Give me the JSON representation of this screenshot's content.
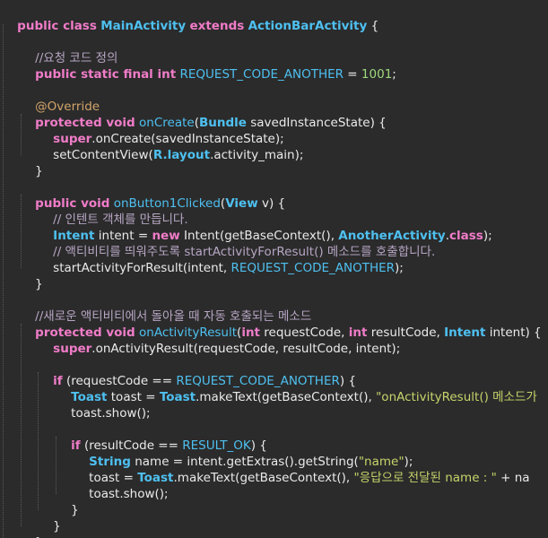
{
  "code": {
    "class_kw": "public class",
    "class_name": "MainActivity",
    "extends_kw": "extends",
    "parent_class": "ActionBarActivity",
    "open_brace": "{",
    "comment_request_code": "//요청 코드 정의",
    "const_modifiers": "public static final int",
    "const_name": "REQUEST_CODE_ANOTHER",
    "const_eq": " = ",
    "const_value": "1001",
    "semicolon": ";",
    "override": "@Override",
    "protected_void": "protected void",
    "on_create": "onCreate",
    "bundle_type": "Bundle",
    "saved_param": " savedInstanceState) {",
    "super_kw": "super",
    "super_on_create": ".onCreate(savedInstanceState);",
    "set_content_view": "setContentView(",
    "r_layout": "R.layout",
    "activity_main": ".activity_main);",
    "close_brace": "}",
    "public_void": "public void",
    "on_button_clicked": "onButton1Clicked",
    "open_paren": "(",
    "view_type": "View",
    "view_param": " v) {",
    "comment_intent": "// 인텐트 객체를 만듭니다.",
    "intent_type": "Intent",
    "intent_decl": " intent = ",
    "new_kw": "new",
    "intent_ctor": " Intent(getBaseContext(), ",
    "another_activity": "AnotherActivity",
    "dot": ".",
    "class_kw2": "class",
    "close_paren_semi": ");",
    "comment_start_activity": "// 액티비티를 띄워주도록 startActivityForResult() 메소드를 호출합니다.",
    "start_activity": "startActivityForResult(intent, ",
    "comment_new_activity": "//새로운 액티비티에서 돌아올 때 자동 호출되는 메소드",
    "on_activity_result": "onActivityResult",
    "int_kw": "int",
    "request_code_param": " requestCode, ",
    "result_code_param": " resultCode, ",
    "intent_param": " intent) {",
    "super_on_activity_result": ".onActivityResult(requestCode, resultCode, intent);",
    "if_kw": "if",
    "if_request_open": " (requestCode == ",
    "close_paren_brace": ") {",
    "toast_type": "Toast",
    "toast_decl": " toast = ",
    "toast_make_text": ".makeText(getBaseContext(), ",
    "str_on_activity_result": "\"onActivityResult() 메소드가",
    "toast_show": "toast.show();",
    "if_result_open": " (resultCode == ",
    "result_ok": "RESULT_OK",
    "string_type": "String",
    "name_decl": " name = intent.getExtras().getString(",
    "str_name": "\"name\"",
    "toast_assign": "toast = ",
    "str_response": "\"응답으로 전달된 name : \"",
    "plus_na": " + na"
  }
}
